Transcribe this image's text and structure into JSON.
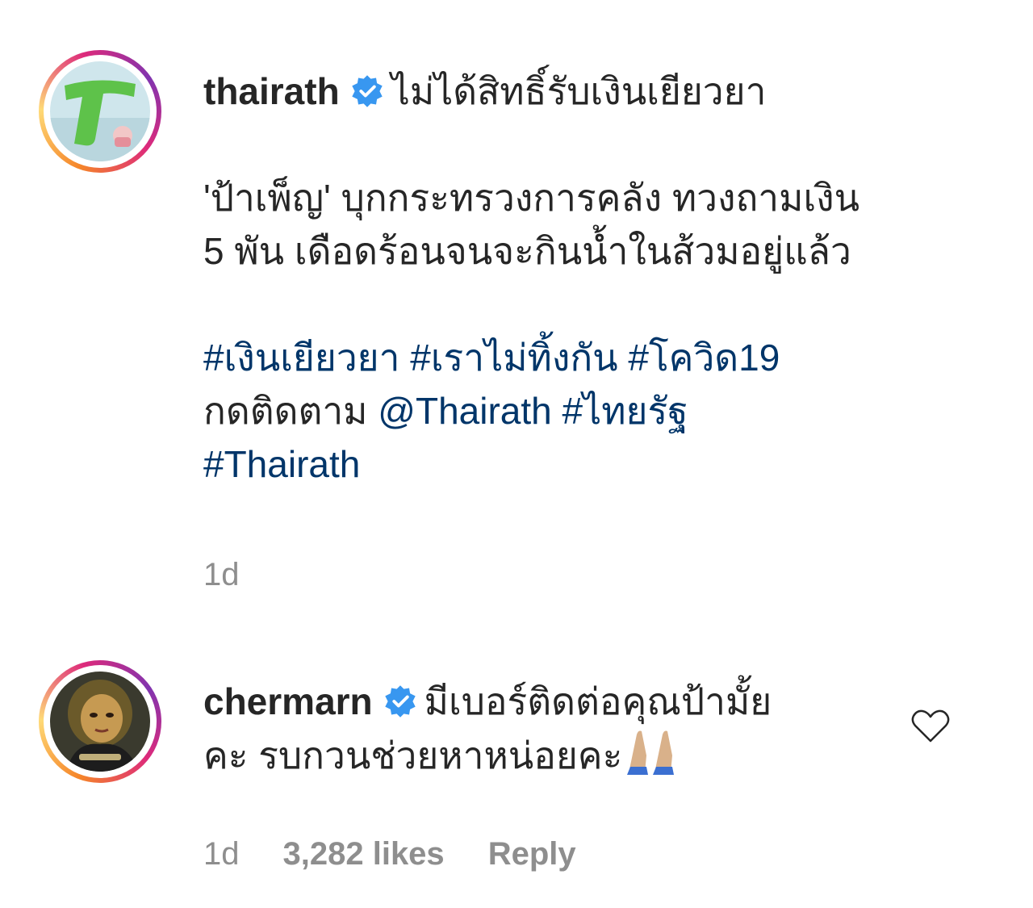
{
  "post": {
    "username": "thairath",
    "headline": "ไม่ได้สิทธิ์รับเงินเยียวยา",
    "body_lines": [
      "'ป้าเพ็ญ' บุกกระทรวงการคลัง ทวงถามเงิน",
      "5 พัน เดือดร้อนจนจะกินน้ำในส้วมอยู่แล้ว"
    ],
    "hashtag_line_1": "#เงินเยียวยา #เราไม่ทิ้งกัน #โควิด19",
    "follow_prefix": "กดติดตาม",
    "follow_mention": "@Thairath #ไทยรัฐ",
    "hashtag_line_3": "#Thairath",
    "time": "1d"
  },
  "comment": {
    "username": "chermarn",
    "text_line_1": "มีเบอร์ติดต่อคุณป้ามั้ย",
    "text_line_2": "คะ รบกวนช่วยหาหน่อยคะ",
    "time": "1d",
    "likes": "3,282 likes",
    "reply_label": "Reply"
  },
  "icons": {
    "verified": "verified-badge-icon",
    "like": "heart-icon",
    "emoji": "folded-hands-emoji"
  },
  "colors": {
    "verified_blue": "#3897f0",
    "link_blue": "#003569",
    "meta_gray": "#8e8e8e",
    "text": "#262626"
  }
}
